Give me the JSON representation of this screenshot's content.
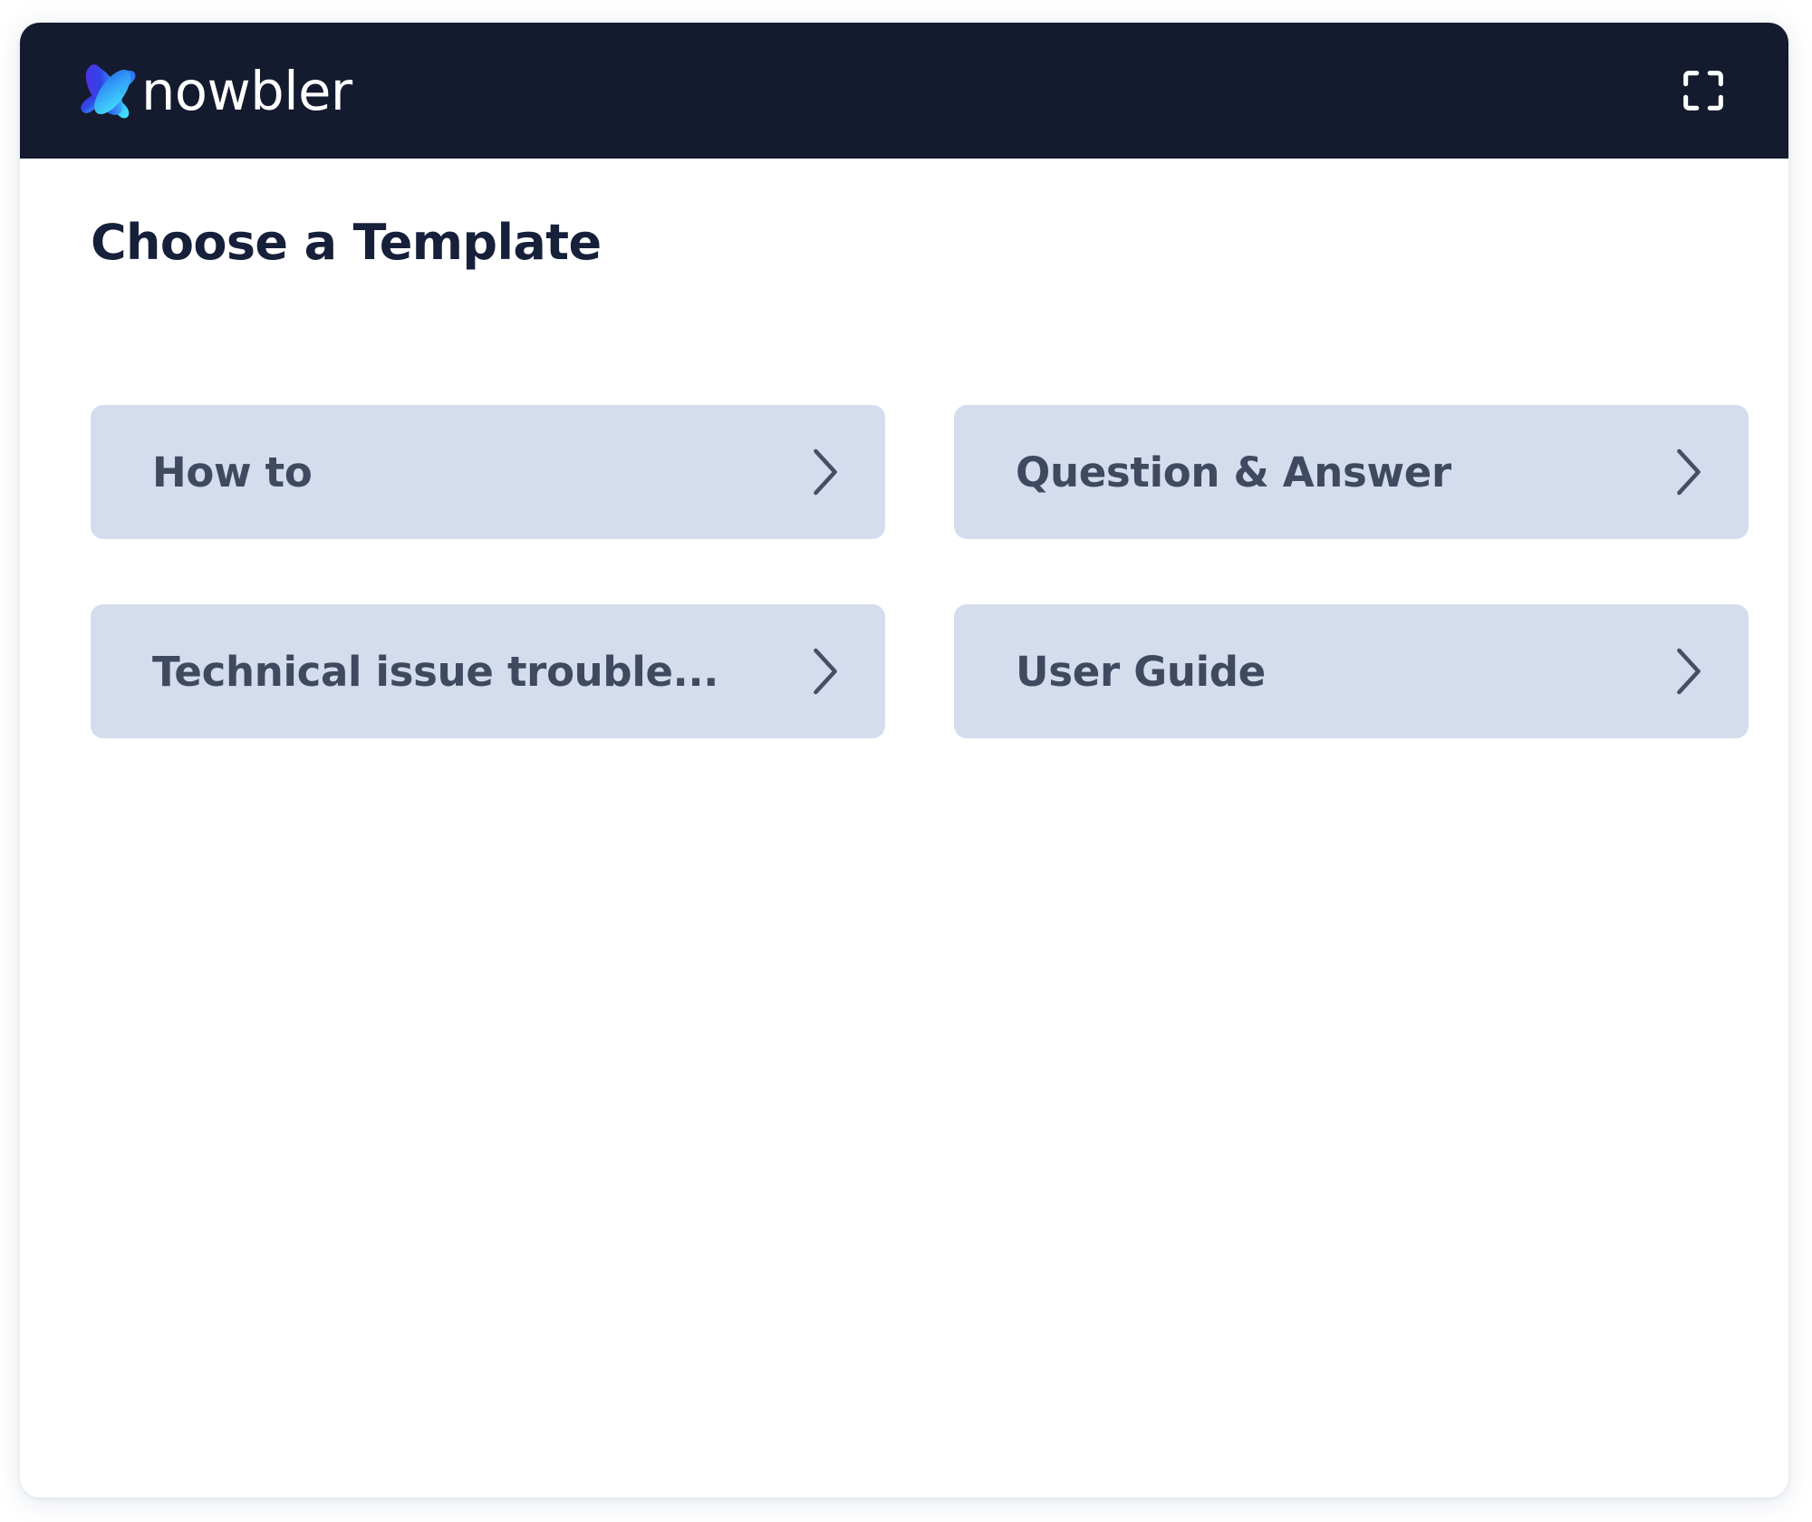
{
  "header": {
    "brand_name": "nowbler",
    "logo_icon": "knowbler-logo-icon",
    "fullscreen_icon": "fullscreen-expand-icon",
    "bar_color": "#141b2e"
  },
  "main": {
    "title": "Choose a Template",
    "title_color": "#17203a",
    "card_bg_color": "#d3dded",
    "card_text_color": "#3f4a60",
    "templates": [
      {
        "label": "How to",
        "chevron_icon": "chevron-right-icon"
      },
      {
        "label": "Question & Answer",
        "chevron_icon": "chevron-right-icon"
      },
      {
        "label": "Technical issue trouble...",
        "chevron_icon": "chevron-right-icon"
      },
      {
        "label": "User Guide",
        "chevron_icon": "chevron-right-icon"
      }
    ]
  }
}
